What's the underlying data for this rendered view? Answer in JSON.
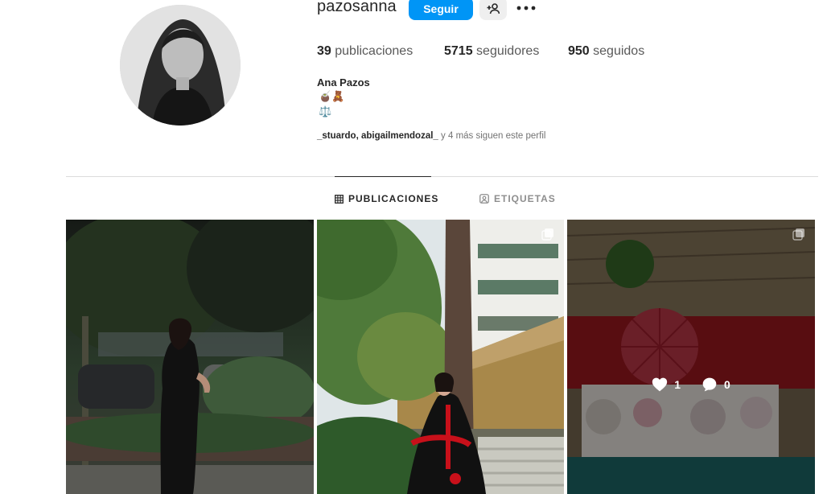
{
  "profile": {
    "username": "pazosanna",
    "follow_label": "Seguir",
    "full_name": "Ana Pazos",
    "bio_line_1": "🧉🧸",
    "bio_line_2": "⚖️"
  },
  "stats": {
    "posts_count": "39",
    "posts_label": "publicaciones",
    "followers_count": "5715",
    "followers_label": "seguidores",
    "following_count": "950",
    "following_label": "seguidos"
  },
  "followed_by": {
    "names": "_stuardo, abigailmendozal_",
    "suffix": "y 4 más siguen este perfil"
  },
  "tabs": [
    {
      "label": "PUBLICACIONES",
      "icon": "grid-icon",
      "active": true
    },
    {
      "label": "ETIQUETAS",
      "icon": "tag-icon",
      "active": false
    }
  ],
  "posts": [
    {
      "multi": false
    },
    {
      "multi": true
    },
    {
      "multi": true,
      "hover": true,
      "likes": "1",
      "comments": "0"
    }
  ],
  "colors": {
    "accent": "#0095f6",
    "text": "#262626",
    "muted": "#737373",
    "divider": "#dbdbdb"
  }
}
